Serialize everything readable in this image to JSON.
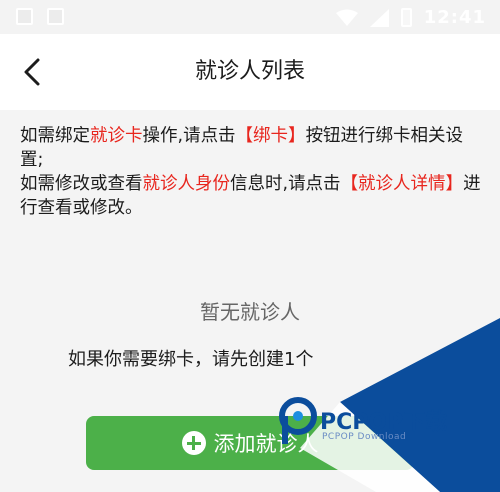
{
  "status_bar": {
    "time": "12:41"
  },
  "header": {
    "title": "就诊人列表"
  },
  "instructions": {
    "p1_a": "如需绑定",
    "p1_b": "就诊卡",
    "p1_c": "操作,请点击",
    "p1_d": "【绑卡】",
    "p1_e": "按钮进行绑卡相关设置;",
    "p2_a": "如需修改或查看",
    "p2_b": "就诊人身份",
    "p2_c": "信息时,请点击",
    "p2_d": "【就诊人详情】",
    "p2_e": "进行查看或修改。"
  },
  "empty": {
    "title": "暂无就诊人",
    "hint": "如果你需要绑卡，请先创建1个"
  },
  "add_button": {
    "label": "添加就诊人"
  },
  "watermark": {
    "brand": "PCPOP下载",
    "sub": "PCPOP Download"
  },
  "colors": {
    "accent_green": "#4cb049",
    "highlight_red": "#e8261e",
    "watermark_blue": "#0b4d9c"
  }
}
